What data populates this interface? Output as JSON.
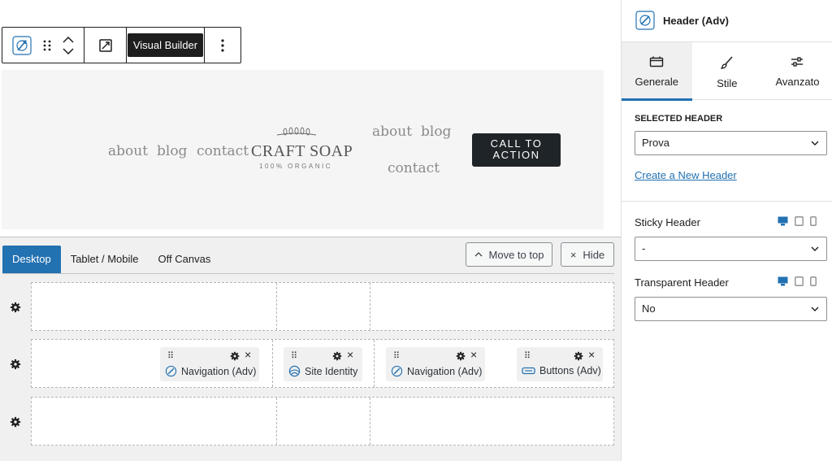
{
  "toolbar": {
    "visual_builder_label": "Visual Builder"
  },
  "preview": {
    "nav_left": [
      "about",
      "blog",
      "contact"
    ],
    "logo": {
      "title": "CRAFT SOAP",
      "subtitle": "100% ORGANIC"
    },
    "nav_right_top": [
      "about",
      "blog"
    ],
    "nav_right_bottom": "contact",
    "cta_line1": "CALL TO",
    "cta_line2": "ACTION"
  },
  "builder": {
    "tabs": [
      {
        "label": "Desktop",
        "active": true
      },
      {
        "label": "Tablet / Mobile",
        "active": false
      },
      {
        "label": "Off Canvas",
        "active": false
      }
    ],
    "move_to_top_label": "Move to top",
    "hide_label": "Hide",
    "items": [
      {
        "label": "Navigation (Adv)",
        "icon": "compass-icon"
      },
      {
        "label": "Site Identity",
        "icon": "globe-icon"
      },
      {
        "label": "Navigation (Adv)",
        "icon": "compass-icon"
      },
      {
        "label": "Buttons (Adv)",
        "icon": "button-icon"
      }
    ]
  },
  "sidebar": {
    "title": "Header (Adv)",
    "tabs": [
      {
        "label": "Generale",
        "icon": "header-icon",
        "active": true
      },
      {
        "label": "Stile",
        "icon": "brush-icon",
        "active": false
      },
      {
        "label": "Avanzato",
        "icon": "sliders-icon",
        "active": false
      }
    ],
    "selected_header_label": "SELECTED HEADER",
    "selected_header_value": "Prova",
    "create_link": "Create a New Header",
    "sticky_label": "Sticky Header",
    "sticky_value": "-",
    "transparent_label": "Transparent Header",
    "transparent_value": "No"
  },
  "colors": {
    "accent": "#2271b1",
    "cta_bg": "#1f2429",
    "preview_bg": "#f5f5f6"
  }
}
